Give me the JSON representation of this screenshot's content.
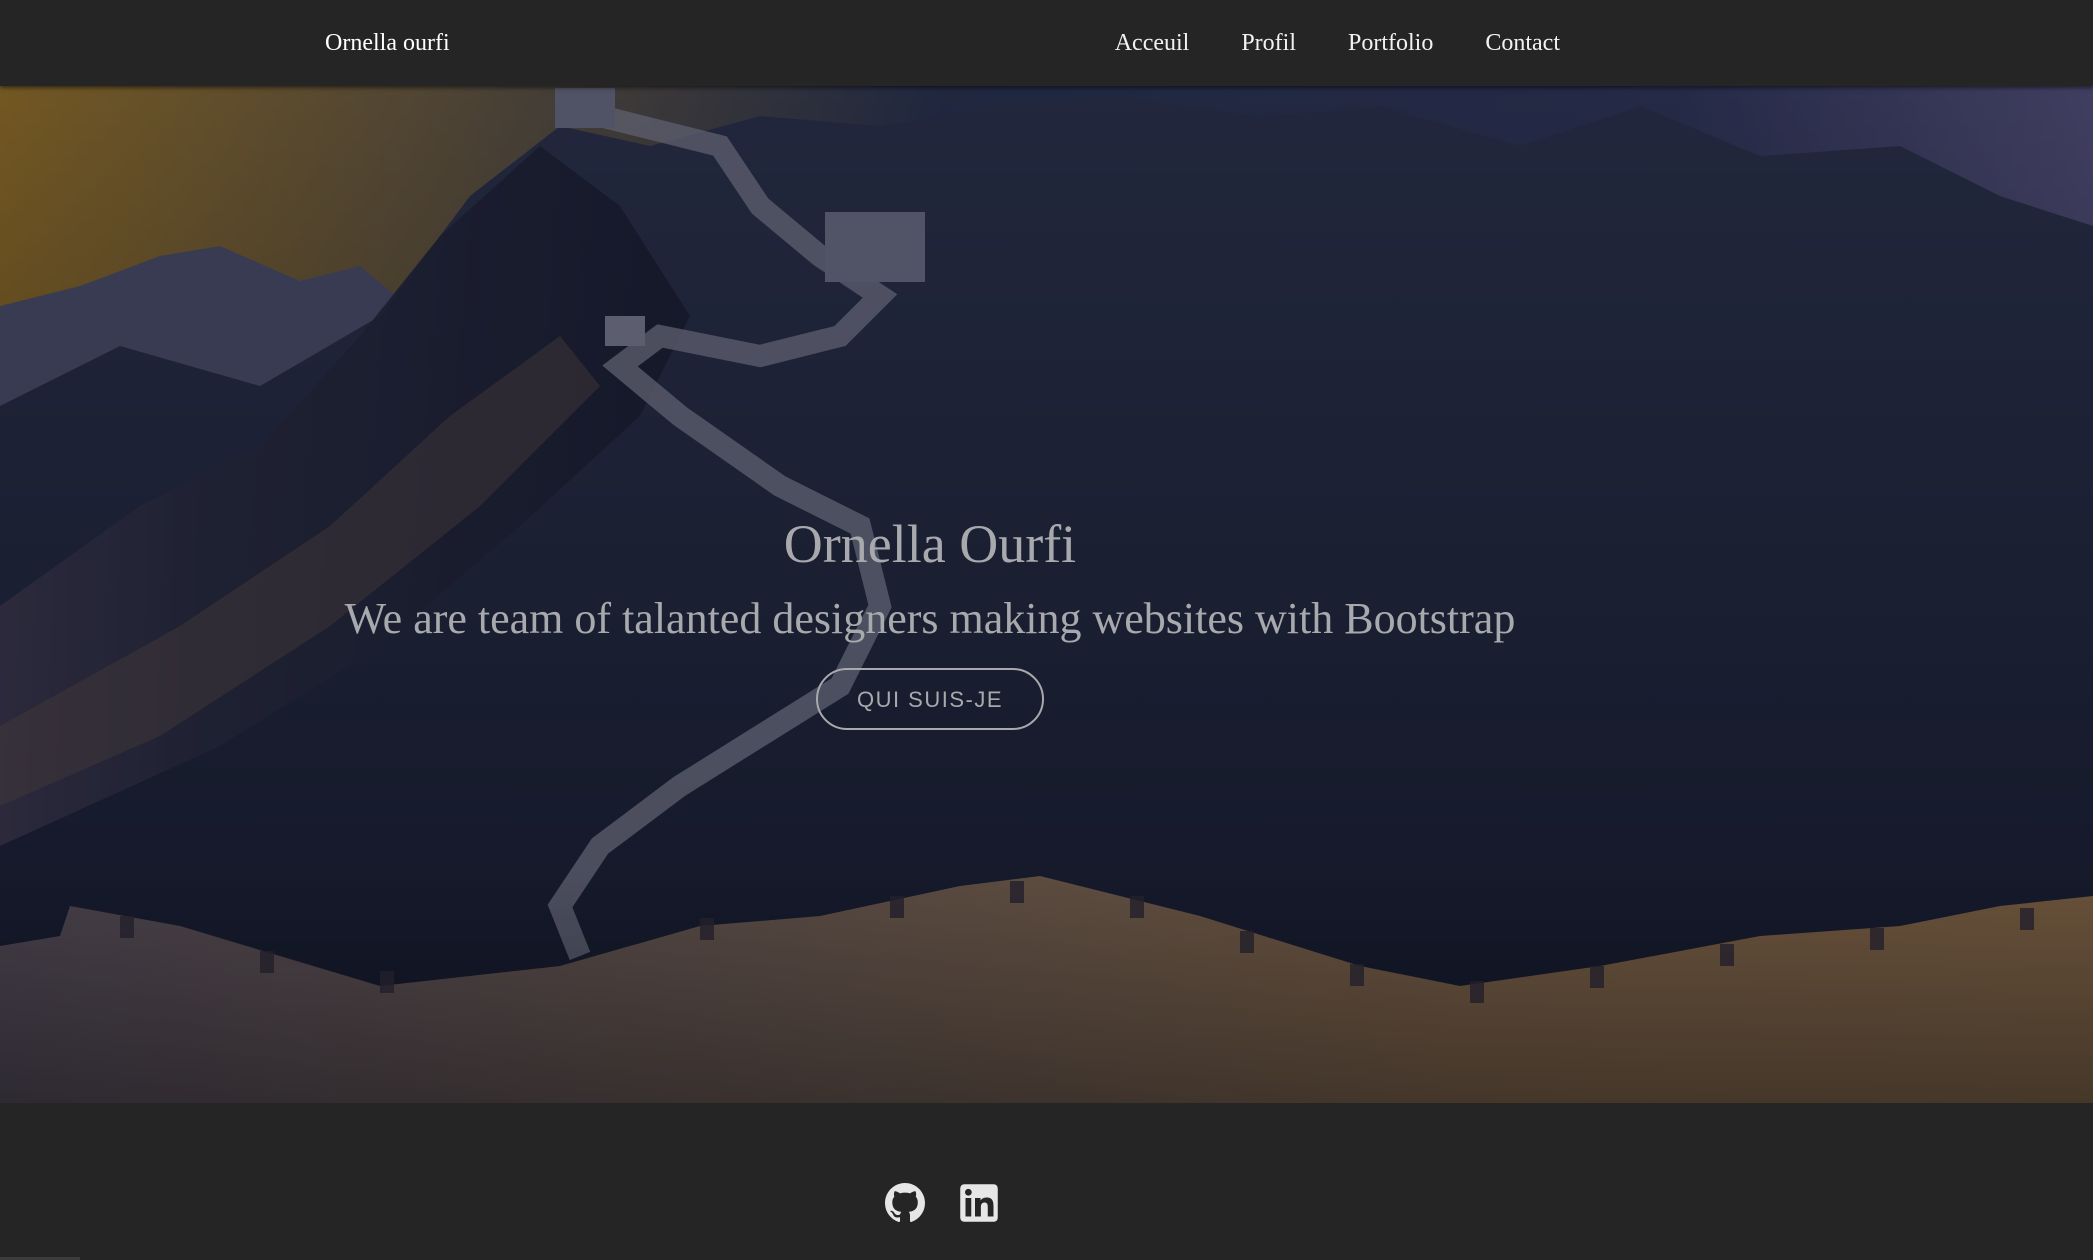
{
  "navbar": {
    "brand": "Ornella ourfi",
    "links": [
      {
        "label": "Acceuil"
      },
      {
        "label": "Profil"
      },
      {
        "label": "Portfolio"
      },
      {
        "label": "Contact"
      }
    ]
  },
  "hero": {
    "title": "Ornella Ourfi",
    "subtitle": "We are team of talanted designers making websites with Bootstrap",
    "button_label": "QUI SUIS-JE"
  },
  "footer": {
    "icons": [
      "github-icon",
      "linkedin-icon"
    ]
  },
  "colors": {
    "navbar_bg": "#252525",
    "hero_text": "#a8a9ad",
    "nav_text": "#f2f2f2"
  }
}
